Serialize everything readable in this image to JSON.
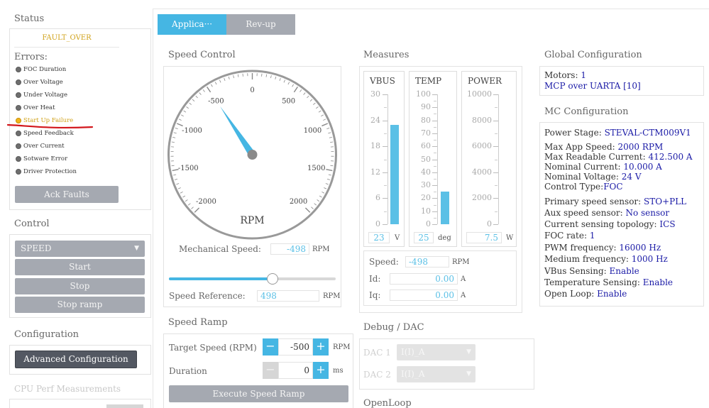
{
  "status": {
    "title": "Status",
    "state": "FAULT_OVER",
    "errors_label": "Errors:",
    "errors": [
      {
        "label": "FOC Duration",
        "active": false
      },
      {
        "label": "Over Voltage",
        "active": false
      },
      {
        "label": "Under Voltage",
        "active": false
      },
      {
        "label": "Over Heat",
        "active": false
      },
      {
        "label": "Start Up Failure",
        "active": true
      },
      {
        "label": "Speed Feedback",
        "active": false
      },
      {
        "label": "Over Current",
        "active": false
      },
      {
        "label": "Sotware Error",
        "active": false
      },
      {
        "label": "Driver Protection",
        "active": false
      }
    ],
    "ack_button": "Ack Faults"
  },
  "control": {
    "title": "Control",
    "mode_select": "SPEED",
    "start": "Start",
    "stop": "Stop",
    "stop_ramp": "Stop ramp"
  },
  "configuration": {
    "title": "Configuration",
    "advanced_button": "Advanced Configuration"
  },
  "cpu_perf": {
    "title": "CPU Perf Measurements"
  },
  "tabs": [
    {
      "label": "Applica···",
      "active": true
    },
    {
      "label": "Rev-up",
      "active": false
    }
  ],
  "speed_control": {
    "title": "Speed Control",
    "gauge_unit": "RPM",
    "gauge_ticks": [
      "-2000",
      "-1500",
      "-1000",
      "-500",
      "0",
      "500",
      "1000",
      "1500",
      "2000"
    ],
    "needle_value": -498,
    "mech_speed_label": "Mechanical Speed:",
    "mech_speed_value": "-498",
    "mech_speed_unit": "RPM",
    "speed_ref_label": "Speed Reference:",
    "speed_ref_value": "498",
    "speed_ref_unit": "RPM",
    "slider_fraction": 0.62
  },
  "speed_ramp": {
    "title": "Speed Ramp",
    "target_label": "Target Speed (RPM)",
    "target_value": "-500",
    "target_unit": "RPM",
    "duration_label": "Duration",
    "duration_value": "0",
    "duration_unit": "ms",
    "minus": "−",
    "plus": "+",
    "execute": "Execute Speed Ramp"
  },
  "measures": {
    "title": "Measures",
    "vbus": {
      "title": "VBUS",
      "ticks": [
        "30",
        "24",
        "18",
        "12",
        "6",
        "0"
      ],
      "value": "23",
      "unit": "V",
      "fraction": 0.767
    },
    "temp": {
      "title": "TEMP",
      "ticks": [
        "100",
        "90",
        "80",
        "70",
        "60",
        "50",
        "40",
        "30",
        "20",
        "10",
        "0"
      ],
      "value": "25",
      "unit": "deg",
      "fraction": 0.25
    },
    "power": {
      "title": "POWER",
      "ticks": [
        "10000",
        "8000",
        "6000",
        "4000",
        "2000",
        "0"
      ],
      "value": "7.5",
      "unit": "W",
      "fraction": 0.0
    },
    "speed_label": "Speed:",
    "speed_value": "-498",
    "speed_unit": "RPM",
    "id_label": "Id:",
    "id_value": "0.00",
    "id_unit": "A",
    "iq_label": "Iq:",
    "iq_value": "0.00",
    "iq_unit": "A"
  },
  "debug": {
    "title": "Debug / DAC",
    "dac1_label": "DAC 1",
    "dac1_value": "I(I)_A",
    "dac2_label": "DAC 2",
    "dac2_value": "I(I)_A"
  },
  "openloop": {
    "title": "OpenLoop"
  },
  "global_config": {
    "title": "Global Configuration",
    "motors_label": "Motors:",
    "motors_value": "1",
    "protocol": "MCP over UARTA [10]"
  },
  "mc_config": {
    "title": "MC Configuration",
    "rows": [
      {
        "label": "Power Stage: ",
        "value": "STEVAL-CTM009V1"
      },
      {
        "label": "Max App Speed: ",
        "value": "2000 RPM"
      },
      {
        "label": "Max Readable Current: ",
        "value": "412.500 A"
      },
      {
        "label": "Nominal Current: ",
        "value": "10.000 A"
      },
      {
        "label": "Nominal Voltage: ",
        "value": "24 V"
      },
      {
        "label": "Control Type:",
        "value": "FOC"
      },
      {
        "label": "Primary speed sensor: ",
        "value": "STO+PLL"
      },
      {
        "label": "Aux speed sensor: ",
        "value": "No sensor"
      },
      {
        "label": "Current sensing topology: ",
        "value": "ICS"
      },
      {
        "label": "FOC rate: ",
        "value": "1"
      },
      {
        "label": "PWM frequency: ",
        "value": "16000 Hz"
      },
      {
        "label": "Medium frequency: ",
        "value": "1000 Hz"
      },
      {
        "label": "VBus Sensing: ",
        "value": "Enable"
      },
      {
        "label": "Temperature Sensing: ",
        "value": "Enable"
      },
      {
        "label": "Open Loop: ",
        "value": "Enable"
      }
    ]
  },
  "colors": {
    "accent": "#45b6e3",
    "bar": "#5bc0e6",
    "fault": "#d0a21a",
    "annotation": "#d2161b"
  }
}
